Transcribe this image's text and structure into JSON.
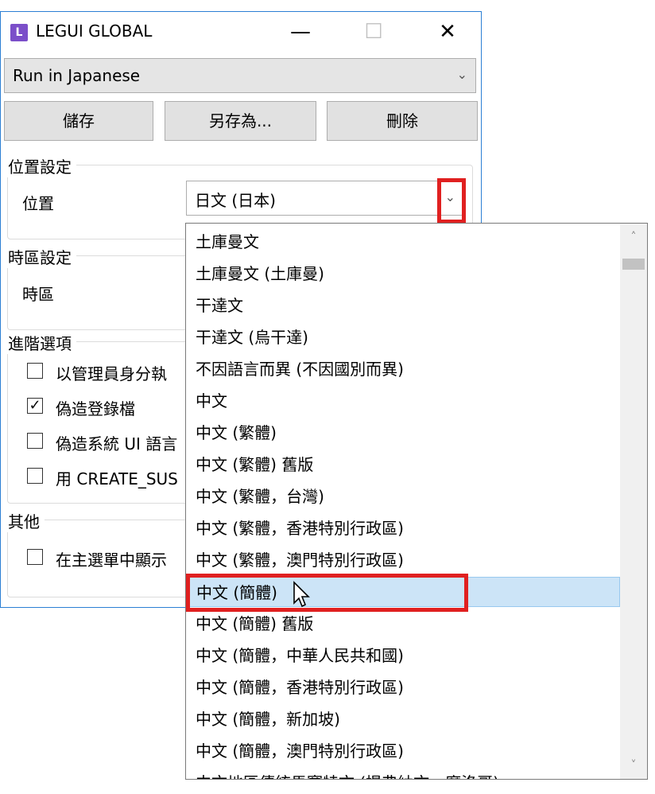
{
  "window": {
    "app_icon_letter": "L",
    "title": "LEGUI GLOBAL",
    "minimize_glyph": "—",
    "maximize_glyph": "☐",
    "close_glyph": "✕"
  },
  "profile": {
    "selected": "Run in Japanese",
    "arrow": "⌄"
  },
  "buttons": {
    "save": "儲存",
    "save_as": "另存為...",
    "delete": "刪除"
  },
  "location_group": {
    "title": "位置設定",
    "label": "位置",
    "value": "日文 (日本)",
    "arrow": "⌄"
  },
  "timezone_group": {
    "title": "時區設定",
    "label": "時區"
  },
  "advanced_group": {
    "title": "進階選項",
    "options": [
      {
        "label": "以管理員身分執",
        "checked": false
      },
      {
        "label": "偽造登錄檔",
        "checked": true
      },
      {
        "label": "偽造系統 UI 語言",
        "checked": false
      },
      {
        "label": "用 CREATE_SUS",
        "checked": false
      }
    ]
  },
  "other_group": {
    "title": "其他",
    "options": [
      {
        "label": "在主選單中顯示",
        "checked": false
      }
    ]
  },
  "dropdown": {
    "selected_index": 11,
    "items": [
      "土庫曼文",
      "土庫曼文 (土庫曼)",
      "干達文",
      "干達文 (烏干達)",
      "不因語言而異 (不因國別而異)",
      "中文",
      "中文 (繁體)",
      "中文 (繁體) 舊版",
      "中文 (繁體，台灣)",
      "中文 (繁體，香港特別行政區)",
      "中文 (繁體，澳門特別行政區)",
      "中文 (簡體)",
      "中文 (簡體) 舊版",
      "中文 (簡體，中華人民共和國)",
      "中文 (簡體，香港特別行政區)",
      "中文 (簡體，新加坡)",
      "中文 (簡體，澳門特別行政區)",
      "中文地區傳統馬賽特文 (提弗納文，摩洛哥)"
    ],
    "scroll_up": "˄",
    "scroll_down": "˅"
  },
  "colors": {
    "window_border": "#2b7fd4",
    "highlight": "#e02020",
    "selected_bg": "#cce4f7",
    "app_icon": "#7b4fc9"
  }
}
